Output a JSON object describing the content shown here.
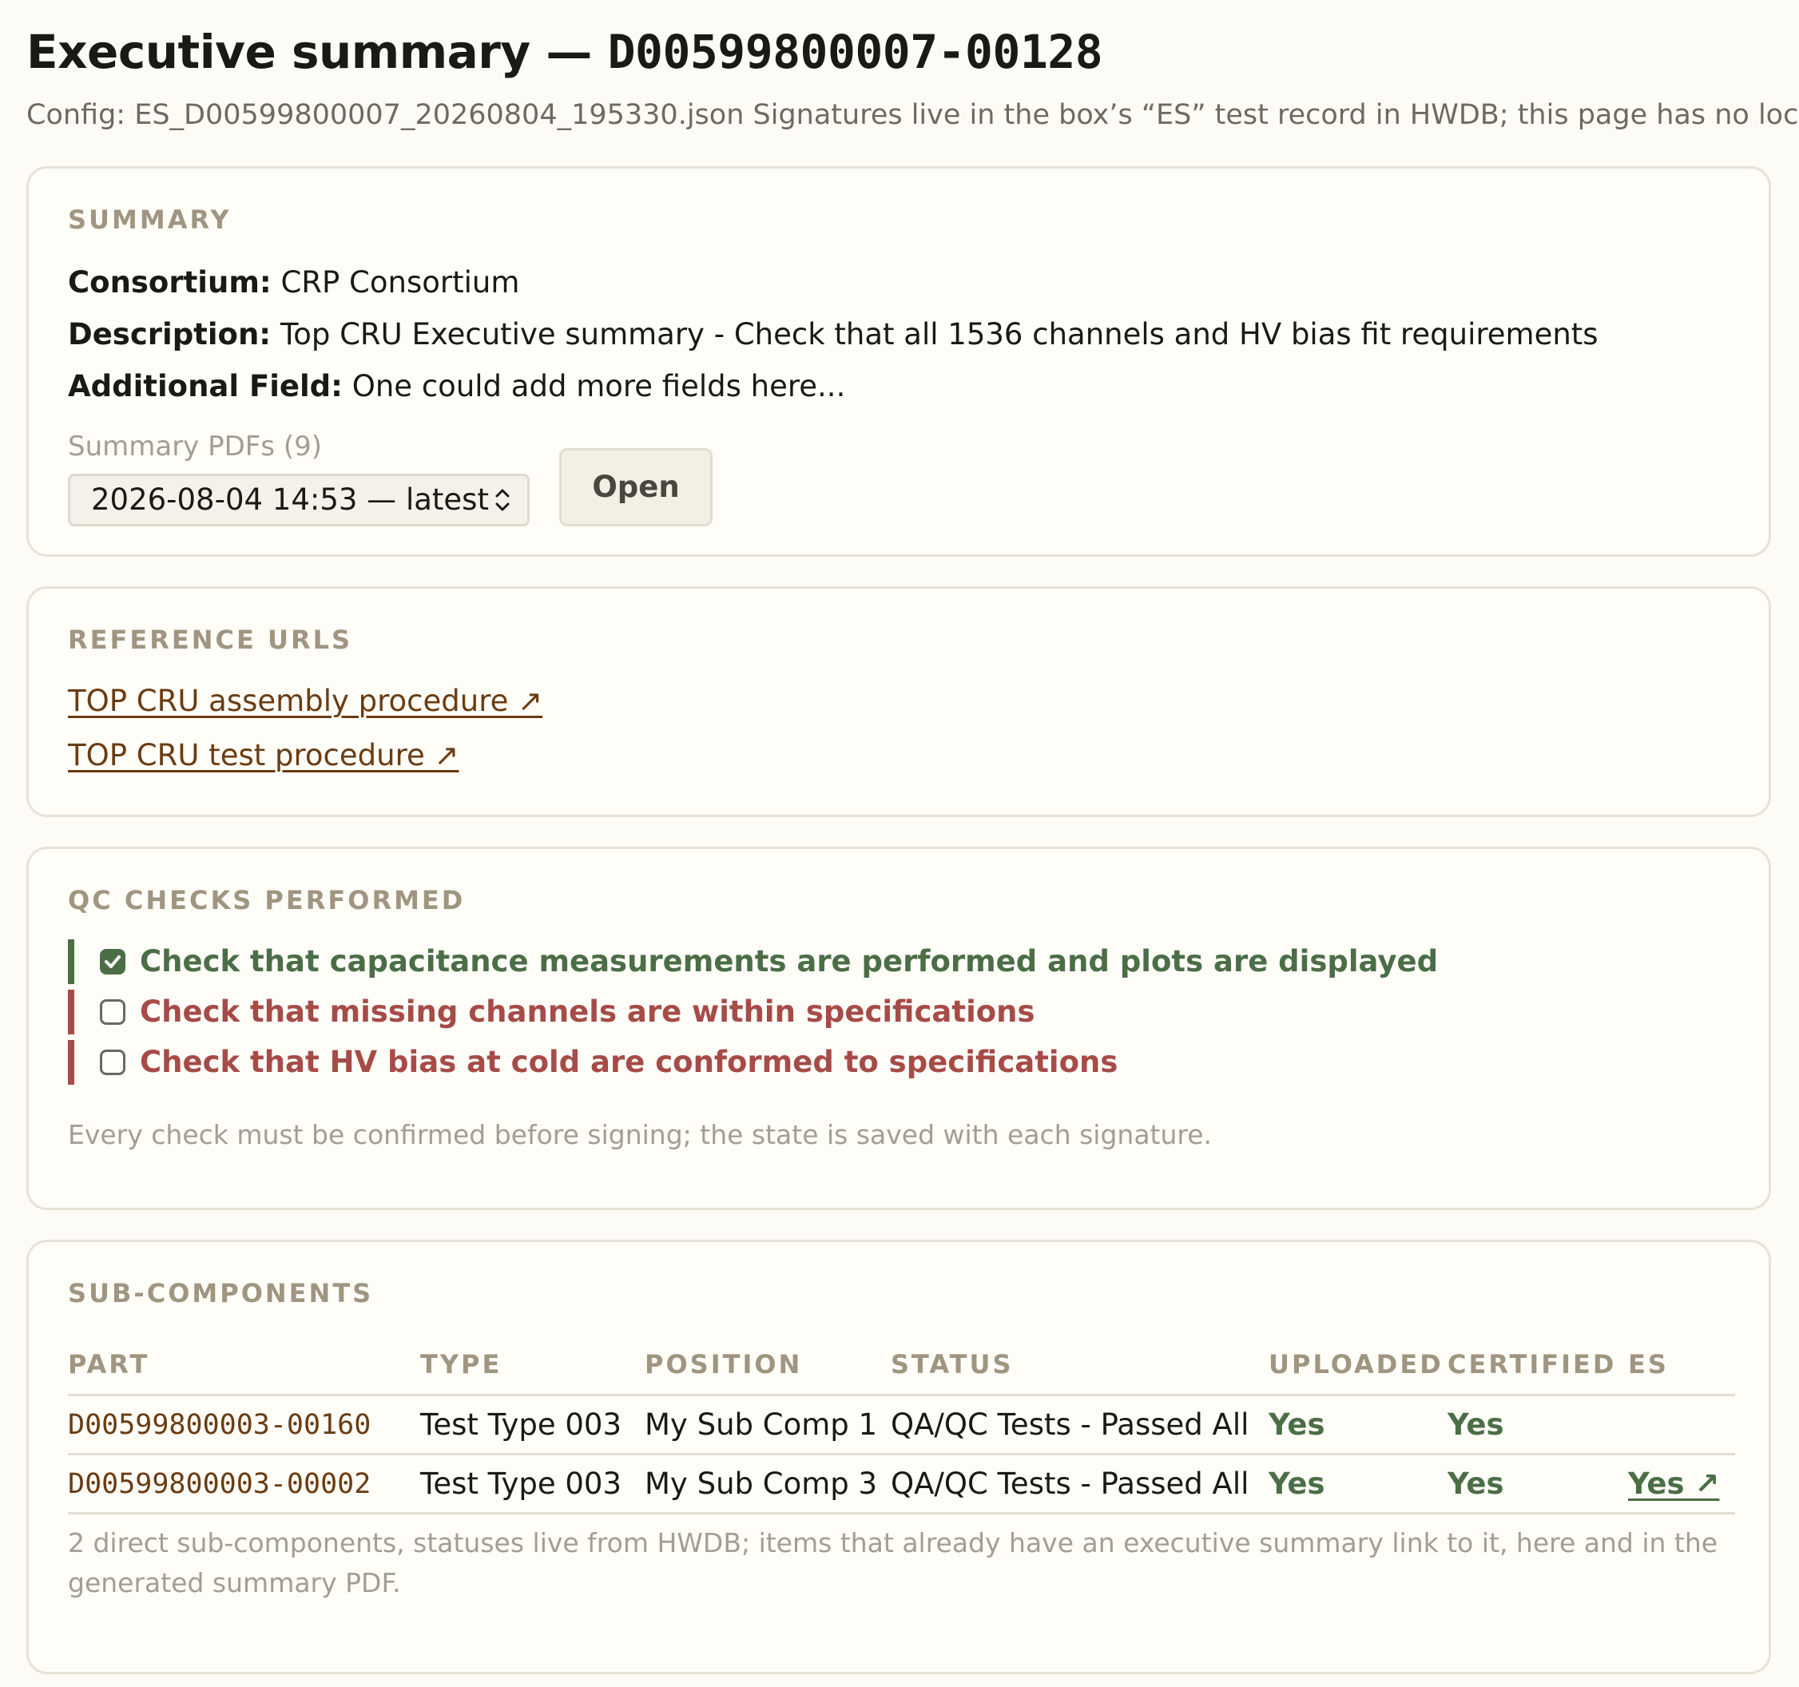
{
  "header": {
    "title_prefix": "Executive summary — ",
    "title_id": "D00599800007-00128",
    "config_text": "Config: ES_D00599800007_20260804_195330.json Signatures live in the box’s “ES” test record in HWDB; this page has no loc"
  },
  "summary": {
    "section_title": "SUMMARY",
    "consortium_label": "Consortium:",
    "consortium_value": "CRP Consortium",
    "description_label": "Description:",
    "description_value": "Top CRU Executive summary - Check that all 1536 channels and HV bias fit requirements",
    "additional_label": "Additional Field:",
    "additional_value": "One could add more fields here...",
    "pdfs_label": "Summary PDFs (9)",
    "pdf_selected": "2026-08-04 14:53 — latest",
    "open_label": "Open",
    "icons": {
      "select": "chevron-up-down-icon"
    }
  },
  "reference_urls": {
    "section_title": "REFERENCE URLS",
    "links": [
      {
        "label": "TOP CRU assembly procedure ↗"
      },
      {
        "label": "TOP CRU test procedure ↗"
      }
    ]
  },
  "qc_checks": {
    "section_title": "QC CHECKS PERFORMED",
    "items": [
      {
        "label": "Check that capacitance measurements are performed and plots are displayed",
        "checked": true
      },
      {
        "label": "Check that missing channels are within specifications",
        "checked": false
      },
      {
        "label": "Check that HV bias at cold are conformed to specifications",
        "checked": false
      }
    ],
    "note": "Every check must be confirmed before signing; the state is saved with each signature.",
    "colors": {
      "pass": "#4b6e46",
      "fail": "#a64b47"
    }
  },
  "sub_components": {
    "section_title": "SUB-COMPONENTS",
    "columns": [
      "PART",
      "TYPE",
      "POSITION",
      "STATUS",
      "UPLOADED",
      "CERTIFIED",
      "ES"
    ],
    "rows": [
      {
        "part": "D00599800003-00160",
        "type": "Test Type 003",
        "position": "My Sub Comp 1",
        "status": "QA/QC Tests - Passed All",
        "uploaded": "Yes",
        "certified": "Yes",
        "es": ""
      },
      {
        "part": "D00599800003-00002",
        "type": "Test Type 003",
        "position": "My Sub Comp 3",
        "status": "QA/QC Tests - Passed All",
        "uploaded": "Yes",
        "certified": "Yes",
        "es": "Yes ↗"
      }
    ],
    "note": "2 direct sub-components, statuses live from HWDB; items that already have an executive summary link to it, here and in the generated summary PDF."
  }
}
